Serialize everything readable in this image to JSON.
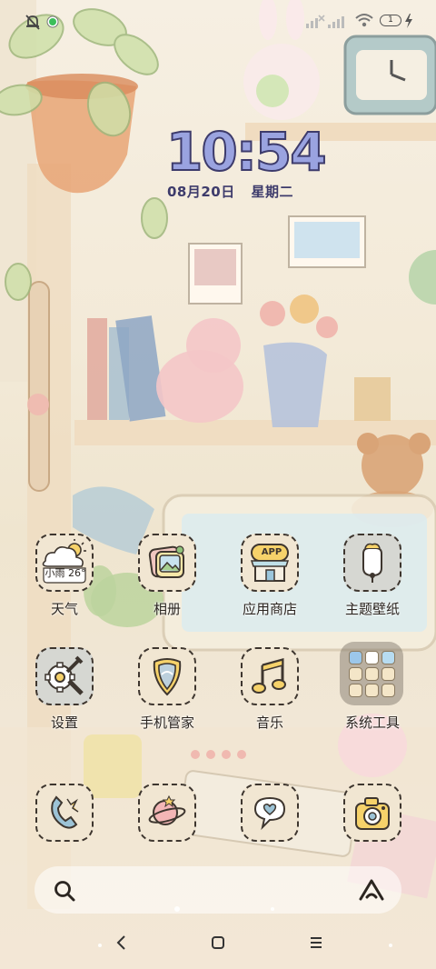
{
  "status_bar": {
    "left_icons": [
      "notification-muted-icon",
      "green-dot-icon"
    ],
    "right_icons": [
      "signal-x-icon",
      "signal-bars-icon",
      "wifi-icon",
      "battery-icon",
      "charging-icon"
    ],
    "battery_level": "1"
  },
  "clock": {
    "time": "10:54",
    "date": "08月20日",
    "weekday": "星期二"
  },
  "weather_widget": {
    "text": "小雨 26°"
  },
  "apps": [
    {
      "label": "天气",
      "icon": "weather-icon"
    },
    {
      "label": "相册",
      "icon": "gallery-icon"
    },
    {
      "label": "应用商店",
      "icon": "app-store-icon",
      "badge_text": "APP"
    },
    {
      "label": "主题壁纸",
      "icon": "theme-wallpaper-icon"
    },
    {
      "label": "设置",
      "icon": "settings-gear-icon"
    },
    {
      "label": "手机管家",
      "icon": "phone-manager-shield-icon"
    },
    {
      "label": "音乐",
      "icon": "music-note-icon"
    },
    {
      "label": "系统工具",
      "icon": "system-tools-folder-icon"
    }
  ],
  "dock": [
    {
      "icon": "phone-icon"
    },
    {
      "icon": "browser-planet-icon"
    },
    {
      "icon": "messages-heart-icon"
    },
    {
      "icon": "camera-icon"
    }
  ],
  "search_bar": {
    "left_icon": "search-icon",
    "right_icon": "assistant-triangle-icon"
  },
  "navigation": {
    "back": "back-icon",
    "home": "home-icon",
    "menu": "recents-menu-icon"
  },
  "colors": {
    "clock_fill": "#9aa3e0",
    "clock_stroke": "#3d3b6b",
    "icon_outline": "#3e362f",
    "wallpaper": "#f3ead8"
  }
}
